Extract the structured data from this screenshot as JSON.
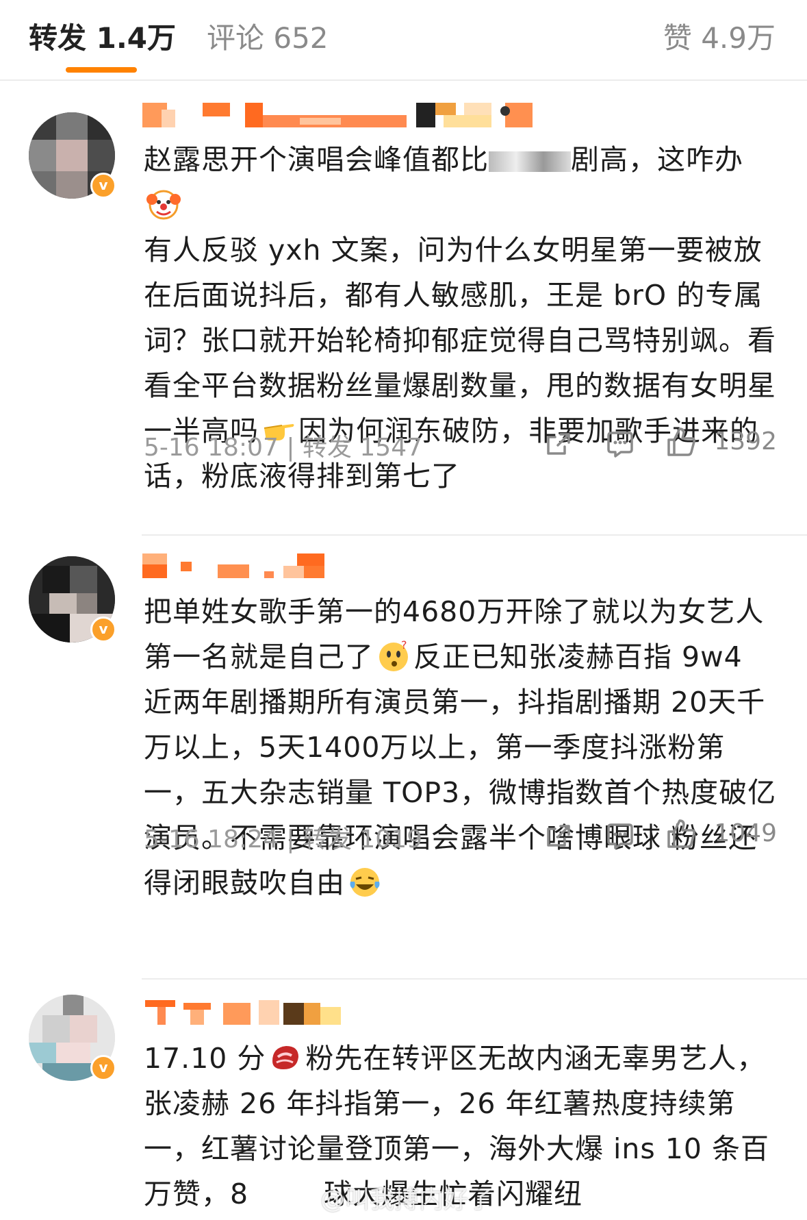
{
  "tabs": {
    "repost": "转发 1.4万",
    "comment": "评论 652",
    "like": "赞 4.9万"
  },
  "colors": {
    "accent": "#ff8200",
    "badge": "#fba02a",
    "meta": "#9a9a9a"
  },
  "comments": [
    {
      "text_parts": [
        "赵露思开个演唱会峰值都比",
        "剧高，这咋办",
        "有人反驳 yxh 文案，问为什么女明星第一要被放在后面说抖后，都有人敏感肌，王是 brO 的专属词？张口就开始轮椅抑郁症觉得自己骂特别飒。看看全平台数据粉丝量爆剧数量，甩的数据有女明星一半高吗",
        "因为何润东破防，非要加歌手进来的话，粉底液得排到第七了"
      ],
      "emojis": [
        "clown-emoji",
        "pointing-hand-emoji"
      ],
      "time": "5-16 18:07",
      "sep": "|",
      "repost": "转发 1547",
      "likes": "1392"
    },
    {
      "text_parts": [
        "把单姓女歌手第一的4680万开除了就以为女艺人第一名就是自己了",
        "反正已知张凌赫百指 9w4 近两年剧播期所有演员第一，抖指剧播期 20天千万以上，5天1400万以上，第一季度抖涨粉第一，五大杂志销量 TOP3，微博指数首个热度破亿演员。不需要靠环演唱会露半个啥博眼球 粉丝还得闭眼鼓吹自由"
      ],
      "emojis": [
        "thinking-face-emoji",
        "laughing-tears-emoji"
      ],
      "time": "5-16 18:24",
      "sep": "|",
      "repost": "转发 1019",
      "likes": "1049"
    },
    {
      "text_parts": [
        "17.10 分",
        "粉先在转评区无故内涵无辜男艺人，张凌赫 26 年抖指第一，26 年红薯热度持续第一，红薯讨论量登顶第一，海外大爆 ins 10 条百万赞，8",
        "球大爆生忙着闪耀纽"
      ],
      "emojis": [
        "meat-emoji"
      ]
    }
  ],
  "watermark": "@叫我搏内好了"
}
